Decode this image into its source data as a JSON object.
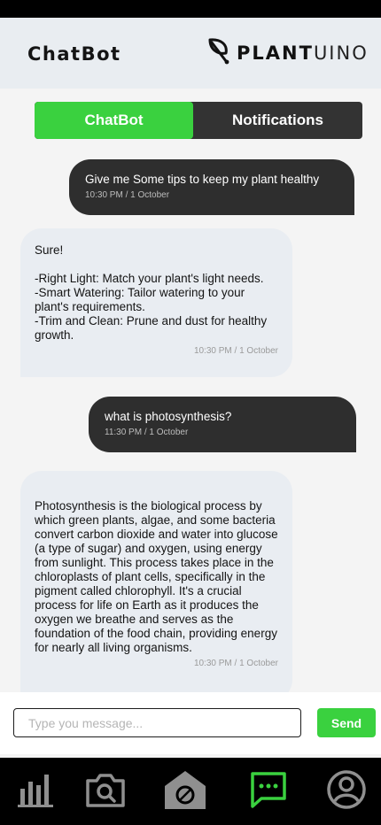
{
  "header": {
    "title": "ChatBot",
    "brand_strong": "PLANT",
    "brand_light": "UINO"
  },
  "tabs": [
    {
      "label": "ChatBot",
      "active": true
    },
    {
      "label": "Notifications",
      "active": false
    }
  ],
  "messages": [
    {
      "sender": "user",
      "text": "Give me Some tips to keep my plant healthy",
      "time": "10:30 PM  / 1 October"
    },
    {
      "sender": "bot",
      "text": "Sure!\n\n-Right Light: Match your plant's light needs.\n-Smart Watering: Tailor watering to your plant's requirements.\n-Trim and Clean: Prune and dust for healthy growth.",
      "time": "10:30 PM  / 1 October"
    },
    {
      "sender": "user",
      "text": "what is photosynthesis?",
      "time": "11:30 PM  / 1 October"
    },
    {
      "sender": "bot",
      "text": "Photosynthesis is the biological process by which green plants, algae, and some bacteria convert carbon dioxide and water into glucose (a type of sugar) and oxygen, using energy from sunlight. This process takes place in the chloroplasts of plant cells, specifically in the pigment called chlorophyll. It's a crucial process for life on Earth as it produces the oxygen we breathe and serves as the foundation of the food chain, providing energy for nearly all living organisms.",
      "time": "10:30 PM  / 1 October"
    }
  ],
  "composer": {
    "placeholder": "Type you message...",
    "value": "",
    "send_label": "Send"
  },
  "nav": [
    {
      "icon": "bar-chart-icon",
      "active": false
    },
    {
      "icon": "camera-search-icon",
      "active": false
    },
    {
      "icon": "greenhouse-icon",
      "active": false
    },
    {
      "icon": "chat-icon",
      "active": true
    },
    {
      "icon": "profile-icon",
      "active": false
    }
  ],
  "colors": {
    "accent": "#3ad13f",
    "dark": "#2e2e2e",
    "bot_bubble": "#e9edf2",
    "header_bg": "#e9edf1"
  }
}
